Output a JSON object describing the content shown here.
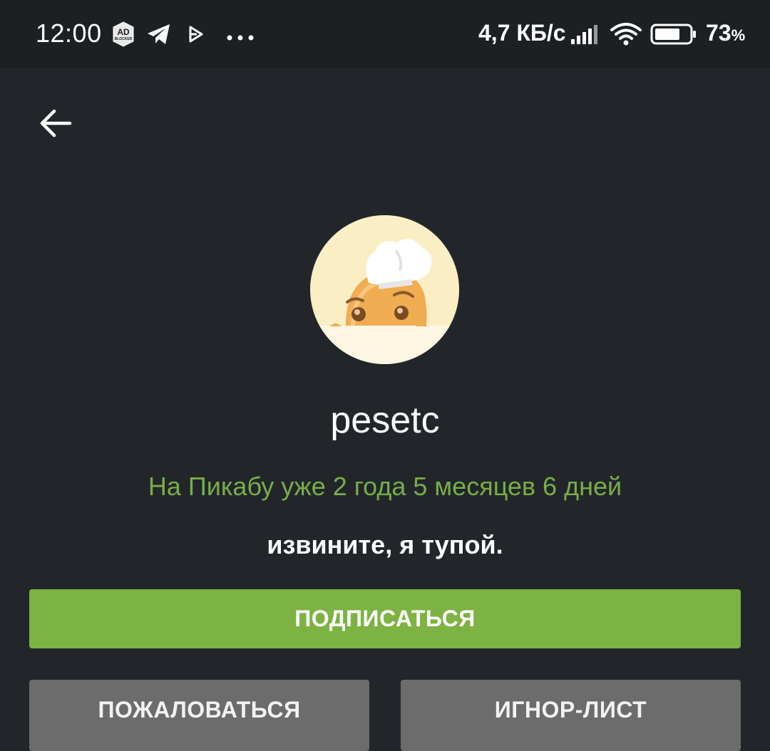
{
  "status_bar": {
    "time": "12:00",
    "adblock_icon": "ad-blocker-icon",
    "adblock_text_top": "AD",
    "adblock_text_bottom": "BLOCKER",
    "telegram_icon": "telegram-icon",
    "play_icon": "play-icon",
    "more_icon": "more-dots-icon",
    "net_speed": "4,7 КБ/с",
    "signal_icon": "signal-icon",
    "wifi_icon": "wifi-icon",
    "battery_icon": "battery-icon",
    "battery_level": 0.73,
    "battery_percent": "73",
    "battery_percent_sign": "%"
  },
  "header": {
    "back_icon": "arrow-left-icon"
  },
  "profile": {
    "avatar_icon": "chef-hat-avatar",
    "username": "pesetc",
    "member_since": "На Пикабу уже 2 года 5 месяцев 6 дней",
    "bio": "извините, я тупой."
  },
  "actions": {
    "subscribe_label": "ПОДПИСАТЬСЯ",
    "report_label": "ПОЖАЛОВАТЬСЯ",
    "ignore_label": "ИГНОР-ЛИСТ"
  },
  "colors": {
    "background": "#22262a",
    "status_bar": "#1d2023",
    "accent_green": "#7cb342",
    "since_text": "#79ad4a",
    "grey_button": "#6c6c6c"
  }
}
